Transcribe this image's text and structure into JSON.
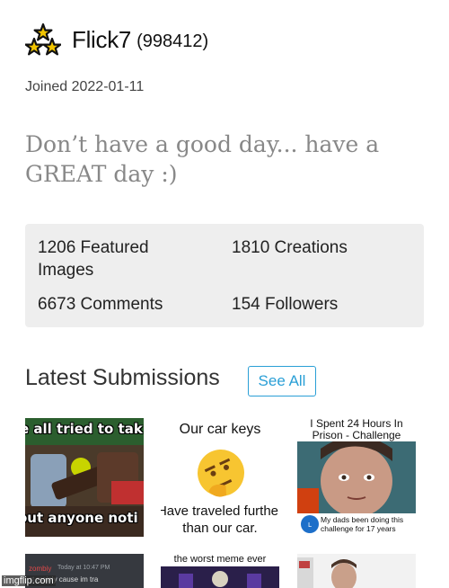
{
  "profile": {
    "username": "Flick7",
    "points": "(998412)",
    "joined": "Joined 2022-01-11",
    "bio": "Don’t have a good day... have a GREAT day :)",
    "rank_icon": "three-stars-icon"
  },
  "stats": {
    "featured": "1206 Featured Images",
    "creations": "1810 Creations",
    "comments": "6673 Comments",
    "followers": "154 Followers"
  },
  "latest": {
    "title": "Latest Submissions",
    "see_all": "See All"
  },
  "thumbnails": [
    {
      "top_text": "e all tried to tak",
      "bottom_text": "out anyone noti"
    },
    {
      "top_text": "Our car keys",
      "bottom_text": "Have traveled further than our car."
    },
    {
      "title": "I Spent 24 Hours In Prison - Challenge",
      "caption": "My dads been doing this challenge for 17 years"
    },
    {
      "name": "zombiy",
      "time": "Today at 10:47 PM",
      "line": "st mainly cause im tra"
    },
    {
      "top_text": "the worst meme ever"
    },
    {}
  ],
  "watermark": "imgflip.com",
  "colors": {
    "accent": "#2a9fd6",
    "stats_bg": "#eeeeee",
    "bio_text": "#888888"
  }
}
